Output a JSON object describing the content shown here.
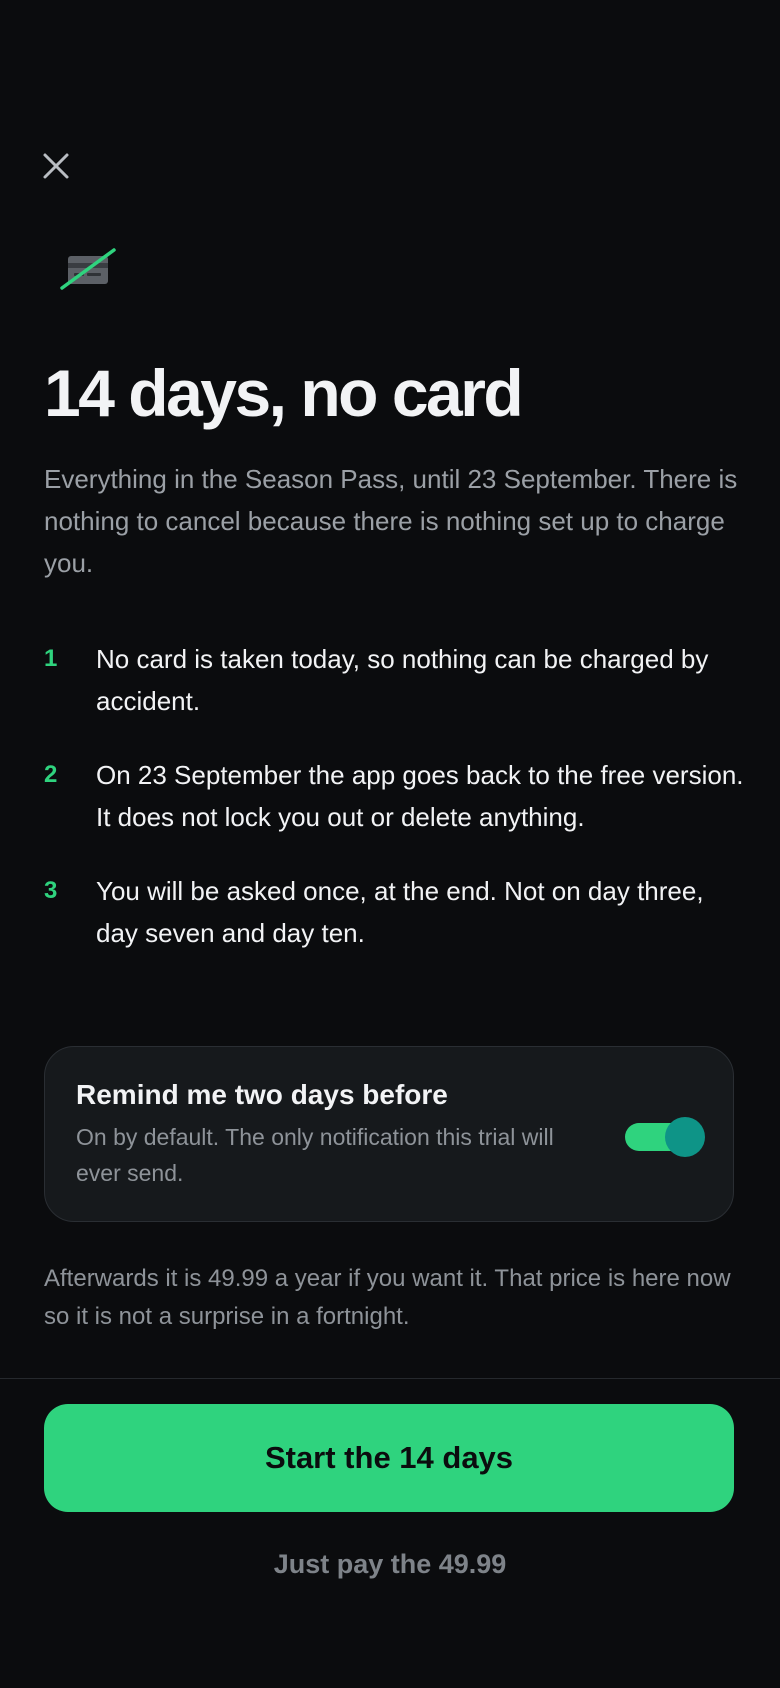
{
  "header": {
    "close_icon": "close-icon",
    "hero_icon": "no-card-icon"
  },
  "hero": {
    "title": "14 days, no card",
    "subtitle": "Everything in the Season Pass, until 23 September. There is nothing to cancel because there is nothing set up to charge you."
  },
  "steps": [
    {
      "num": "1",
      "text": "No card is taken today, so nothing can be charged by accident."
    },
    {
      "num": "2",
      "text": "On 23 September the app goes back to the free version. It does not lock you out or delete anything."
    },
    {
      "num": "3",
      "text": "You will be asked once, at the end. Not on day three, day seven and day ten."
    }
  ],
  "reminder": {
    "title": "Remind me two days before",
    "description": "On by default. The only notification this trial will ever send.",
    "enabled": true
  },
  "pricing_note": "Afterwards it is 49.99 a year if you want it. That price is here now so it is not a surprise in a fortnight.",
  "footer": {
    "primary_label": "Start the 14 days",
    "secondary_label": "Just pay the 49.99"
  },
  "colors": {
    "background": "#0b0c0e",
    "accent": "#2fd37e",
    "toggle_knob": "#0e9487",
    "muted_text": "#9ba0a6"
  }
}
